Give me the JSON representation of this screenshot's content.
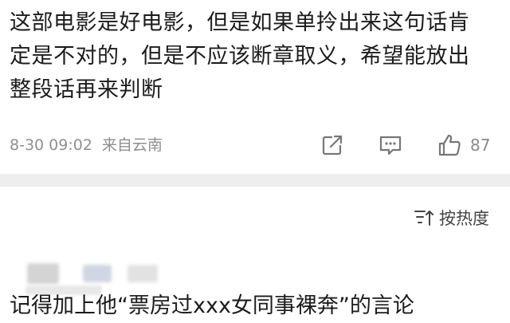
{
  "comment": {
    "lines": [
      "这部电影是好电影，但是如果单拎出来这句话肯",
      "定是不对的，但是不应该断章取义，希望能放出",
      "整段话再来判断"
    ],
    "timestamp": "8-30 09:02",
    "location": "来自云南",
    "like_count": "87"
  },
  "sort": {
    "label": "按热度"
  },
  "reply": {
    "text": "记得加上他“票房过xxx女同事裸奔”的言论"
  },
  "icons": {
    "share": "share-icon",
    "reply": "comment-icon",
    "like": "thumbs-up-icon",
    "sort": "sort-icon"
  },
  "colors": {
    "text": "#1c1c1c",
    "meta": "#8f8f8f",
    "divider": "#eeeeee"
  }
}
